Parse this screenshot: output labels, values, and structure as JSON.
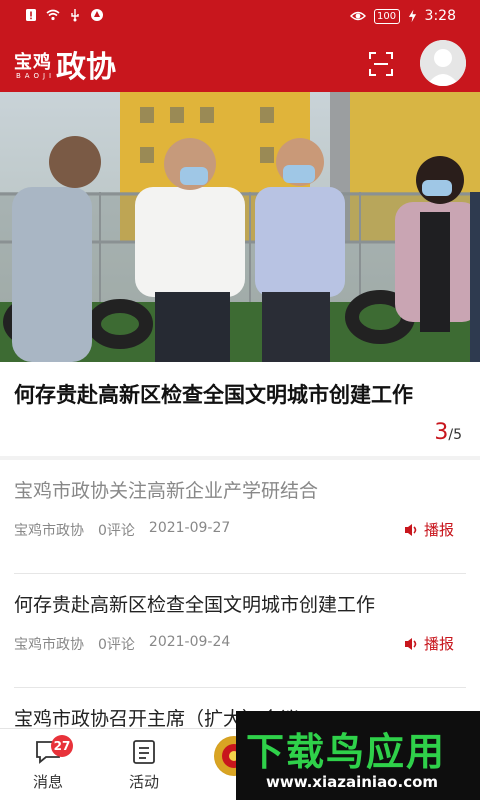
{
  "status_bar": {
    "time": "3:28",
    "battery": "100"
  },
  "header": {
    "logo_small": "宝鸡",
    "logo_sub": "BAOJI",
    "logo_big": "政协"
  },
  "banner": {
    "headline": "何存贵赴高新区检查全国文明城市创建工作",
    "pager_current": "3",
    "pager_total": "/5"
  },
  "news": [
    {
      "title": "宝鸡市政协关注高新企业产学研结合",
      "source": "宝鸡市政协",
      "comments": "0评论",
      "date": "2021-09-27",
      "action": "播报"
    },
    {
      "title": "何存贵赴高新区检查全国文明城市创建工作",
      "source": "宝鸡市政协",
      "comments": "0评论",
      "date": "2021-09-24",
      "action": "播报"
    },
    {
      "title": "宝鸡市政协召开主席（扩大）会议"
    }
  ],
  "tabbar": {
    "messages_label": "消息",
    "messages_badge": "27",
    "activity_label": "活动"
  },
  "watermark": {
    "main": "下载鸟应用",
    "url": "www.xiazainiao.com"
  },
  "colors": {
    "brand_red": "#c8161d",
    "badge_red": "#e8323a",
    "watermark_green": "#2fd14a"
  }
}
